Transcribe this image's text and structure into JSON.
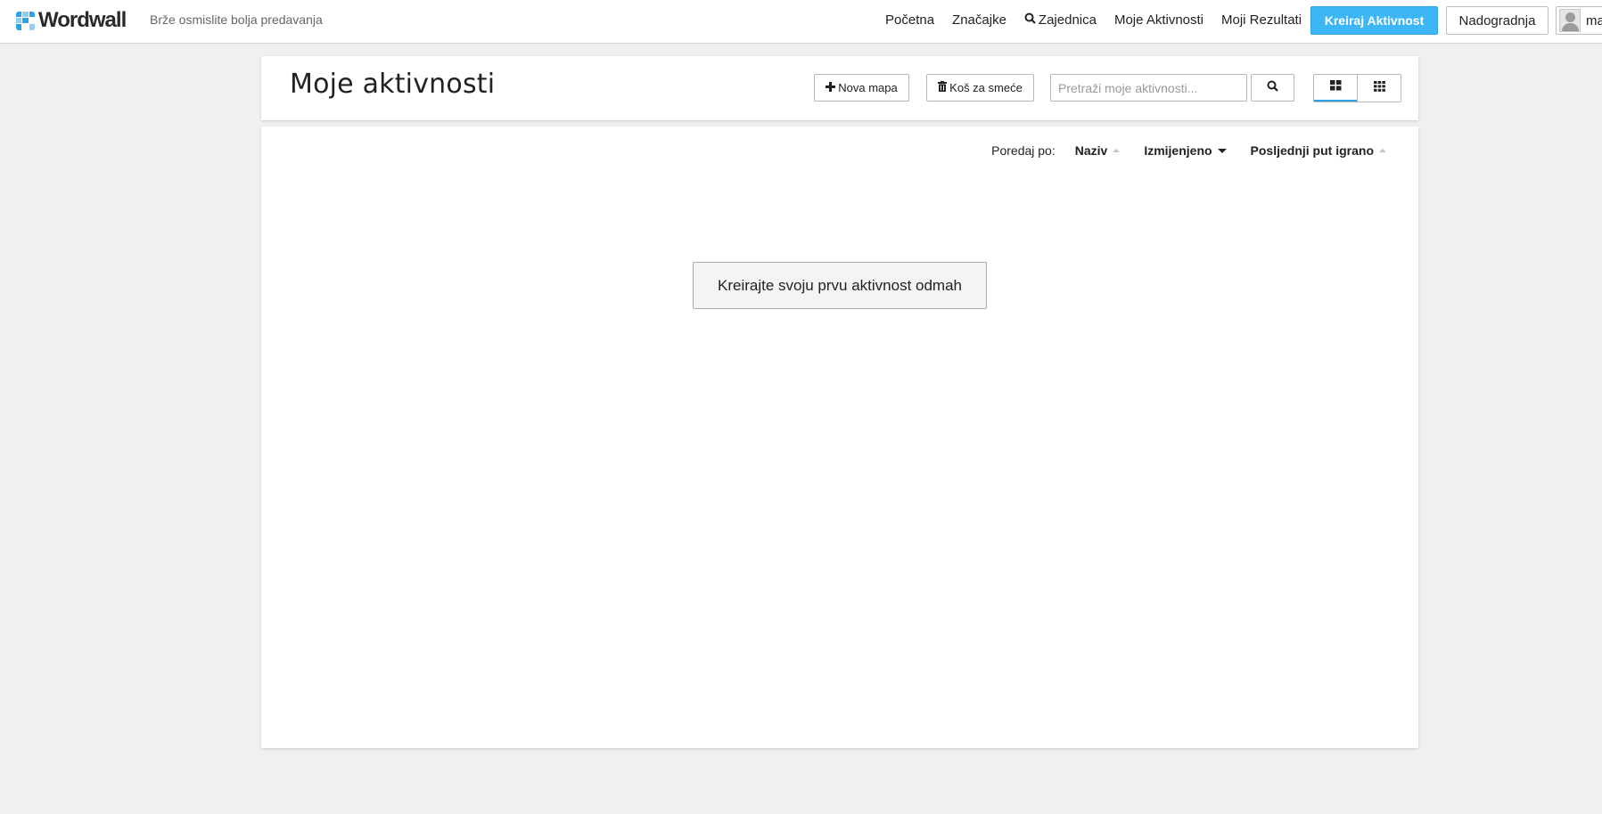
{
  "navbar": {
    "brand_name": "Wordwall",
    "tagline": "Brže osmislite bolja predavanja",
    "links": [
      {
        "label": "Početna",
        "icon": ""
      },
      {
        "label": "Značajke",
        "icon": ""
      },
      {
        "label": "Zajednica",
        "icon": "search-icon"
      },
      {
        "label": "Moje Aktivnosti",
        "icon": ""
      },
      {
        "label": "Moji Rezultati",
        "icon": ""
      }
    ],
    "create_label": "Kreiraj Aktivnost",
    "upgrade_label": "Nadogradnja",
    "user_name": "ma"
  },
  "header": {
    "title": "Moje aktivnosti",
    "new_folder_label": "Nova mapa",
    "trash_label": "Koš za smeće",
    "search_placeholder": "Pretraži moje aktivnosti...",
    "search_value": "",
    "view_modes": [
      "grid-large",
      "grid-small"
    ],
    "active_view": "grid-large"
  },
  "sort": {
    "label": "Poredaj po:",
    "options": [
      {
        "label": "Naziv",
        "direction": "none"
      },
      {
        "label": "Izmijenjeno",
        "direction": "desc-active"
      },
      {
        "label": "Posljednji put igrano",
        "direction": "none"
      }
    ]
  },
  "main": {
    "empty_cta_label": "Kreirajte svoju prvu aktivnost odmah"
  },
  "colors": {
    "accent": "#3cb6f5",
    "background": "#f0f0f0",
    "card": "#ffffff"
  }
}
